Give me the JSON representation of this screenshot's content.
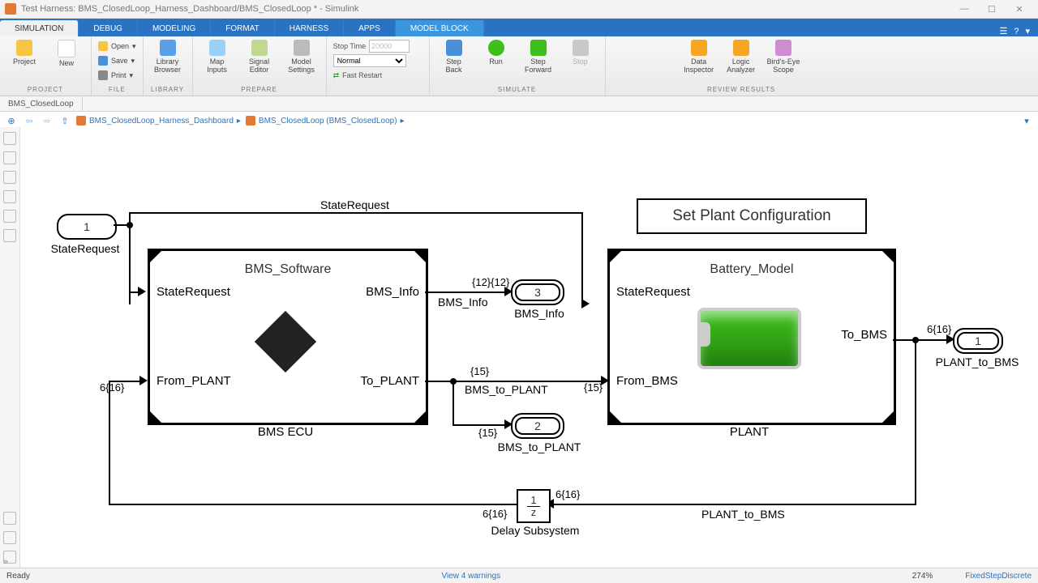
{
  "titlebar": {
    "app_title": "Test Harness: BMS_ClosedLoop_Harness_Dashboard/BMS_ClosedLoop * - Simulink"
  },
  "tabs": {
    "items": [
      "SIMULATION",
      "DEBUG",
      "MODELING",
      "FORMAT",
      "HARNESS",
      "APPS",
      "MODEL BLOCK"
    ],
    "help_icon": "?"
  },
  "toolstrip": {
    "file": {
      "new": "New",
      "project": "Project",
      "open": "Open",
      "save": "Save",
      "print": "Print",
      "group": "FILE",
      "group0": "PROJECT"
    },
    "library": {
      "browser": "Library\nBrowser",
      "group": "LIBRARY"
    },
    "prepare": {
      "map": "Map\nInputs",
      "signal": "Signal\nEditor",
      "settings": "Model\nSettings",
      "group": "PREPARE"
    },
    "sim": {
      "stop_time_lbl": "Stop Time",
      "stop_time_val": "20000",
      "mode": "Normal",
      "fast_restart": "Fast Restart",
      "step_back": "Step\nBack",
      "run": "Run",
      "step_fwd": "Step\nForward",
      "stop": "Stop",
      "group": "SIMULATE"
    },
    "review": {
      "di": "Data\nInspector",
      "la": "Logic\nAnalyzer",
      "be": "Bird's-Eye\nScope",
      "group": "REVIEW RESULTS"
    }
  },
  "doc_tab": "BMS_ClosedLoop",
  "breadcrumbs": {
    "a": "BMS_ClosedLoop_Harness_Dashboard",
    "b": "BMS_ClosedLoop (BMS_ClosedLoop)"
  },
  "diagram": {
    "inport1_num": "1",
    "inport1_label": "StateRequest",
    "sig_staterequest": "StateRequest",
    "bms_block": {
      "title": "BMS_Software",
      "p_in1": "StateRequest",
      "p_in2": "From_PLANT",
      "p_out1": "BMS_Info",
      "p_out2": "To_PLANT",
      "caption": "BMS ECU"
    },
    "sig_bmsinfo": "BMS_Info",
    "dim_bmsinfo": "{12}{12}",
    "out3_num": "3",
    "out3_label": "BMS_Info",
    "sig_bms2plant": "BMS_to_PLANT",
    "dim15": "{15}",
    "out2_num": "2",
    "out2_label": "BMS_to_PLANT",
    "config_button": "Set Plant Configuration",
    "plant_block": {
      "title": "Battery_Model",
      "p_in1": "StateRequest",
      "p_in2": "From_BMS",
      "p_out1": "To_BMS",
      "caption": "PLANT"
    },
    "out1_num": "1",
    "out1_label": "PLANT_to_BMS",
    "dim_6_16": "6{16}",
    "sig_plant2bms": "PLANT_to_BMS",
    "delay_caption": "Delay Subsystem",
    "delay_num": "1",
    "delay_den": "z"
  },
  "footer": {
    "ready": "Ready",
    "warnings": "View 4 warnings",
    "zoom": "274%",
    "solver": "FixedStepDiscrete"
  }
}
